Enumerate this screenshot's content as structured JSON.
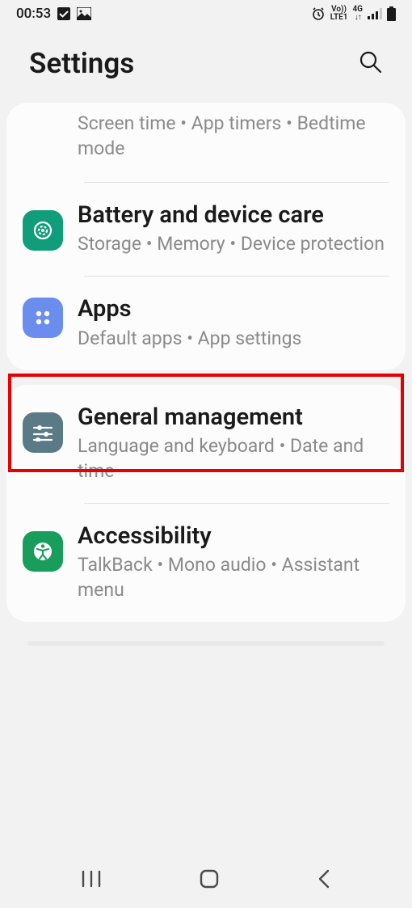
{
  "status": {
    "time": "00:53",
    "network_label_top": "Vo))",
    "network_label_bottom": "LTE1",
    "network_gen": "4G"
  },
  "header": {
    "title": "Settings"
  },
  "card1": {
    "partial": {
      "sub": "Screen time  •  App timers  •  Bedtime mode"
    },
    "battery": {
      "title": "Battery and device care",
      "sub": "Storage  •  Memory  •  Device protection"
    },
    "apps": {
      "title": "Apps",
      "sub": "Default apps  •  App settings"
    }
  },
  "card2": {
    "general": {
      "title": "General management",
      "sub": "Language and keyboard  •  Date and time"
    },
    "a11y": {
      "title": "Accessibility",
      "sub": "TalkBack  •  Mono audio  •  Assistant menu"
    }
  },
  "colors": {
    "icon_battery": "#0f9d7a",
    "icon_apps": "#6a8dee",
    "icon_general": "#5a7a86",
    "icon_a11y": "#189d5c"
  }
}
